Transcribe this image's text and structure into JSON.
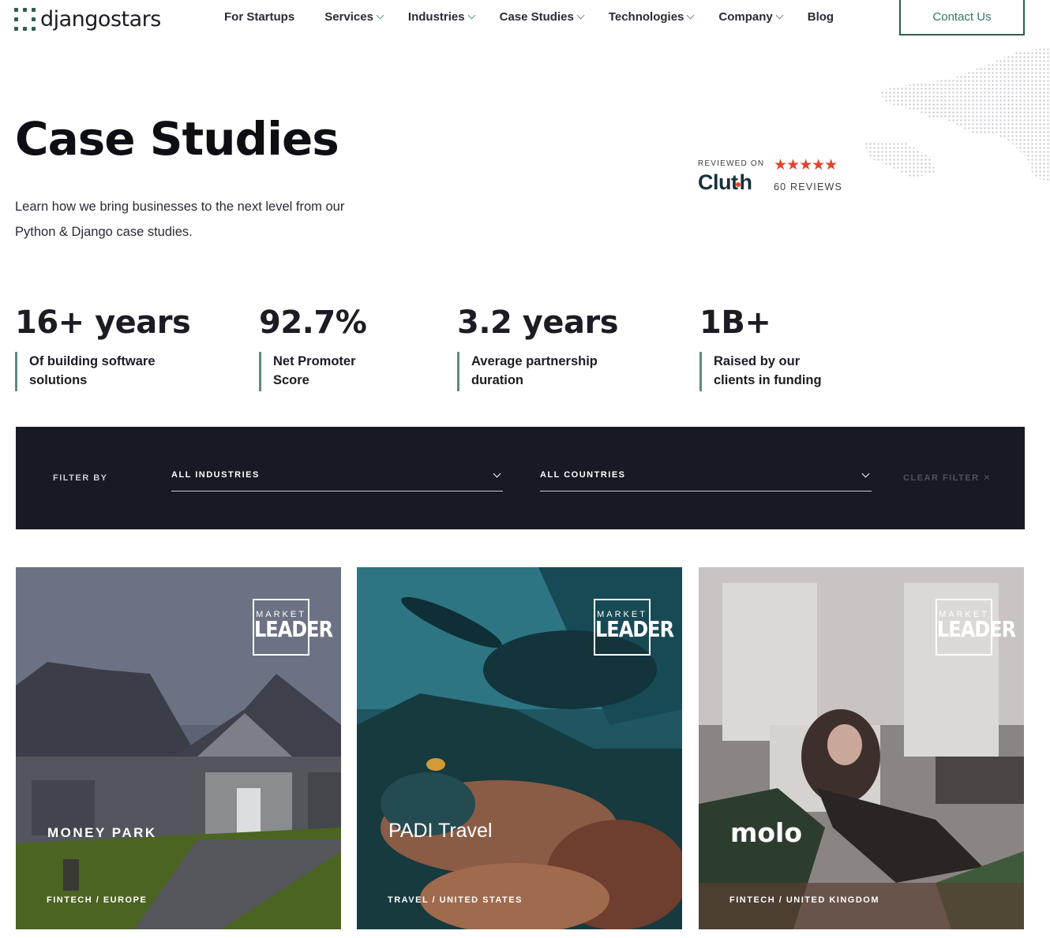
{
  "header": {
    "logo_text": "djangostars",
    "nav": [
      {
        "label": "For Startups",
        "has_dropdown": false
      },
      {
        "label": "Services",
        "has_dropdown": true
      },
      {
        "label": "Industries",
        "has_dropdown": true
      },
      {
        "label": "Case Studies",
        "has_dropdown": true
      },
      {
        "label": "Technologies",
        "has_dropdown": true
      },
      {
        "label": "Company",
        "has_dropdown": true
      },
      {
        "label": "Blog",
        "has_dropdown": false
      }
    ],
    "contact_label": "Contact Us"
  },
  "hero": {
    "title": "Case Studies",
    "subtitle": "Learn how we bring businesses to the next level from our Python & Django case studies."
  },
  "clutch": {
    "reviewed_on": "REVIEWED ON",
    "logo": "Clutch",
    "stars": "★★★★★",
    "rating": 5,
    "reviews": "60 REVIEWS"
  },
  "stats": [
    {
      "value": "16+ years",
      "desc": "Of building software solutions"
    },
    {
      "value": "92.7%",
      "desc": "Net Promoter Score"
    },
    {
      "value": "3.2 years",
      "desc": "Average partnership duration"
    },
    {
      "value": "1B+",
      "desc": "Raised by our clients in funding"
    }
  ],
  "filter": {
    "label": "FILTER BY",
    "industries": "ALL INDUSTRIES",
    "countries": "ALL COUNTRIES",
    "clear": "CLEAR FILTER"
  },
  "cards": [
    {
      "badge_top": "MARKET",
      "badge_bottom": "LEADER",
      "brand": "MONEY PARK",
      "tag": "FINTECH / EUROPE"
    },
    {
      "badge_top": "MARKET",
      "badge_bottom": "LEADER",
      "brand": "PADI Travel",
      "tag": "TRAVEL / UNITED STATES"
    },
    {
      "badge_top": "MARKET",
      "badge_bottom": "LEADER",
      "brand": "molo",
      "tag": "FINTECH / UNITED KINGDOM"
    }
  ],
  "colors": {
    "accent": "#2e5e52",
    "filter_bg": "#171923",
    "star": "#e4422b"
  }
}
